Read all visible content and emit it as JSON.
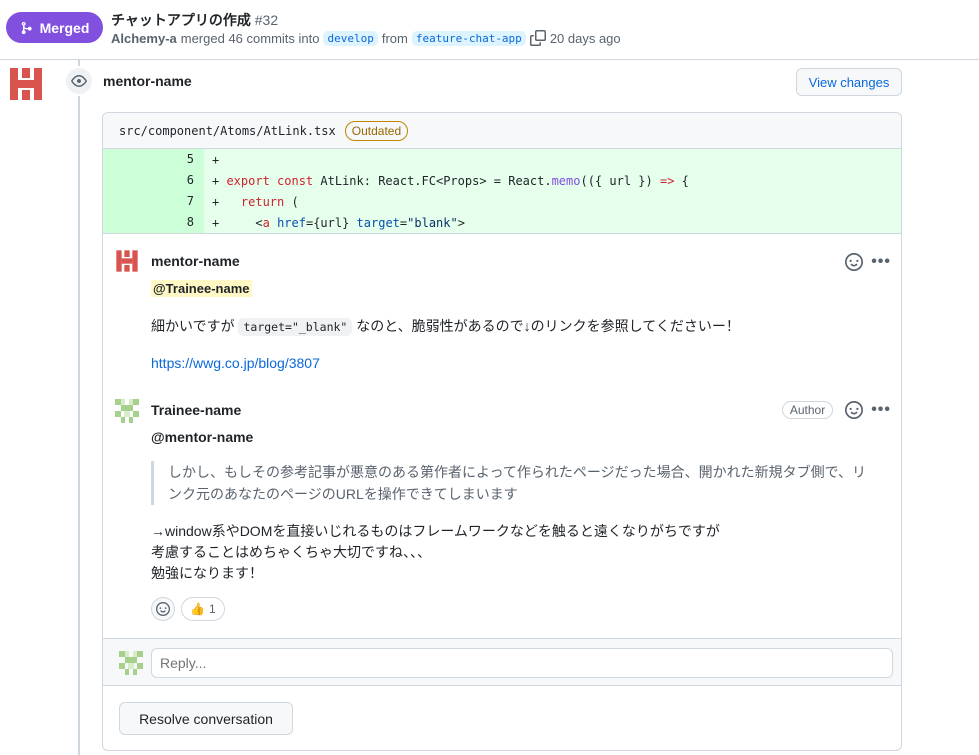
{
  "header": {
    "status_label": "Merged",
    "title": "チャットアプリの作成",
    "number": "#32",
    "author": "Alchemy-a",
    "merged_text": "merged 46 commits into",
    "base_branch": "develop",
    "from_text": "from",
    "head_branch": "feature-chat-app",
    "time_ago": "20 days ago",
    "status_color": "#8250df"
  },
  "review": {
    "reviewer": "mentor-name",
    "view_changes_label": "View changes"
  },
  "file": {
    "path": "src/component/Atoms/AtLink.tsx",
    "badge": "Outdated",
    "lines": [
      {
        "num": "5",
        "prefix": "+",
        "tokens": []
      },
      {
        "num": "6",
        "prefix": "+ ",
        "tokens": [
          {
            "t": "export ",
            "c": "kw"
          },
          {
            "t": "const ",
            "c": "kw"
          },
          {
            "t": "AtLink: React.FC<Props> = React.",
            "c": ""
          },
          {
            "t": "memo",
            "c": "fn"
          },
          {
            "t": "(({ url }) ",
            "c": ""
          },
          {
            "t": "=>",
            "c": "kw"
          },
          {
            "t": " {",
            "c": ""
          }
        ]
      },
      {
        "num": "7",
        "prefix": "+   ",
        "tokens": [
          {
            "t": "return",
            "c": "kw"
          },
          {
            "t": " (",
            "c": ""
          }
        ]
      },
      {
        "num": "8",
        "prefix": "+     ",
        "tokens": [
          {
            "t": "<",
            "c": ""
          },
          {
            "t": "a",
            "c": "kw"
          },
          {
            "t": " ",
            "c": ""
          },
          {
            "t": "href",
            "c": "at"
          },
          {
            "t": "={url} ",
            "c": ""
          },
          {
            "t": "target",
            "c": "at"
          },
          {
            "t": "=",
            "c": ""
          },
          {
            "t": "\"blank\"",
            "c": "st"
          },
          {
            "t": ">",
            "c": ""
          }
        ]
      }
    ]
  },
  "comments": [
    {
      "author": "mentor-name",
      "mention": "@Trainee-name",
      "text_before": "細かいですが",
      "code": "target=\"_blank\"",
      "text_after": "なのと、脆弱性があるので↓のリンクを参照してくださいー！",
      "link": "https://wwg.co.jp/blog/3807"
    },
    {
      "author": "Trainee-name",
      "badge": "Author",
      "mention": "@mentor-name",
      "quote": "しかし、もしその参考記事が悪意のある第作者によって作られたページだった場合、開かれた新規タブ側で、リンク元のあなたのページのURLを操作できてしまいます",
      "lines": [
        "→window系やDOMを直接いじれるものはフレームワークなどを触ると遠くなりがちですが",
        "考慮することはめちゃくちゃ大切ですね、、、",
        "勉強になります！"
      ],
      "reaction_emoji": "👍",
      "reaction_count": "1"
    }
  ],
  "reply": {
    "placeholder": "Reply..."
  },
  "resolve_label": "Resolve conversation"
}
